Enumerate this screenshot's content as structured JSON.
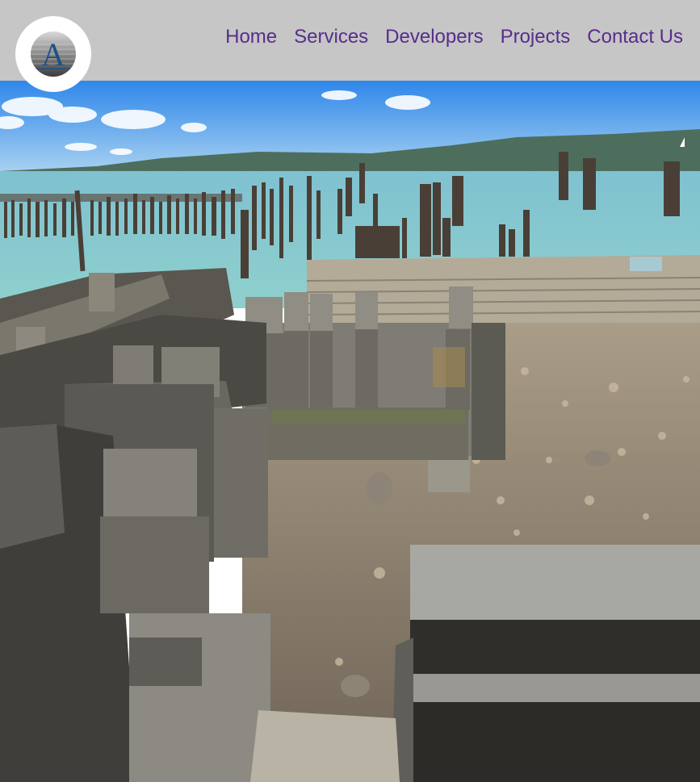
{
  "header": {
    "logo_icon": "company-logo-letter-a",
    "logo_letter": "A",
    "nav": [
      {
        "label": "Home"
      },
      {
        "label": "Services"
      },
      {
        "label": "Developers"
      },
      {
        "label": "Projects"
      },
      {
        "label": "Contact Us"
      }
    ]
  },
  "hero": {
    "image_subject": "concrete-pier-ruins-with-wooden-pilings"
  },
  "colors": {
    "header_bg": "#c6c6c6",
    "nav_text": "#572d8c",
    "logo_blue": "#1f4f86"
  }
}
